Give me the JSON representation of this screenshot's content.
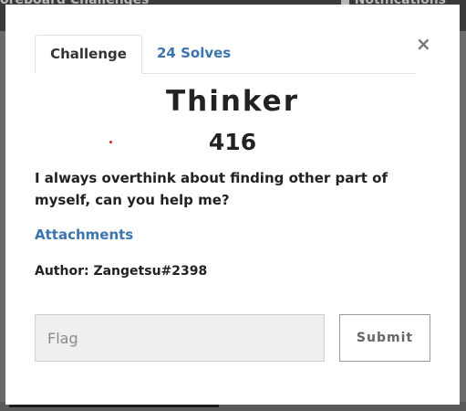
{
  "background": {
    "nav_left_text": "oreboard  Challenges",
    "nav_right_text": "Notifications"
  },
  "modal": {
    "tabs": [
      {
        "label": "Challenge",
        "active": true
      },
      {
        "label": "24 Solves",
        "active": false
      }
    ],
    "close_symbol": "×",
    "title": "Thinker",
    "points": "416",
    "description": "I always overthink about finding other part of myself, can you help me?",
    "attachments_label": "Attachments",
    "author": "Author: Zangetsu#2398",
    "flag_input": {
      "placeholder": "Flag",
      "value": ""
    },
    "submit_label": "Submit"
  },
  "colors": {
    "accent": "#3c74b0",
    "text": "#222222",
    "input_bg": "#efefef"
  }
}
